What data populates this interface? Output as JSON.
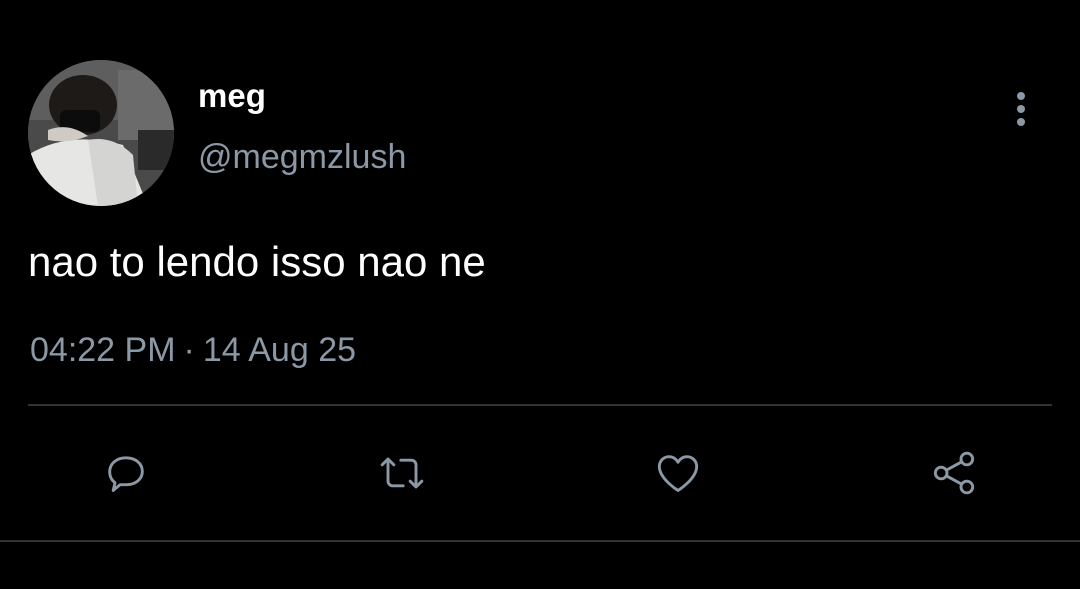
{
  "user": {
    "display_name": "meg",
    "handle": "@megmzlush"
  },
  "tweet": {
    "text": "nao to lendo isso nao ne",
    "time": "04:22 PM",
    "separator": "·",
    "date": "14 Aug 25"
  },
  "icons": {
    "more": "more-vertical-icon",
    "reply": "reply-bubble-icon",
    "retweet": "retweet-icon",
    "like": "heart-icon",
    "share": "share-icon"
  },
  "colors": {
    "background": "#000000",
    "text_primary": "#ffffff",
    "text_secondary": "#8b98a5",
    "divider": "#2f3336"
  }
}
